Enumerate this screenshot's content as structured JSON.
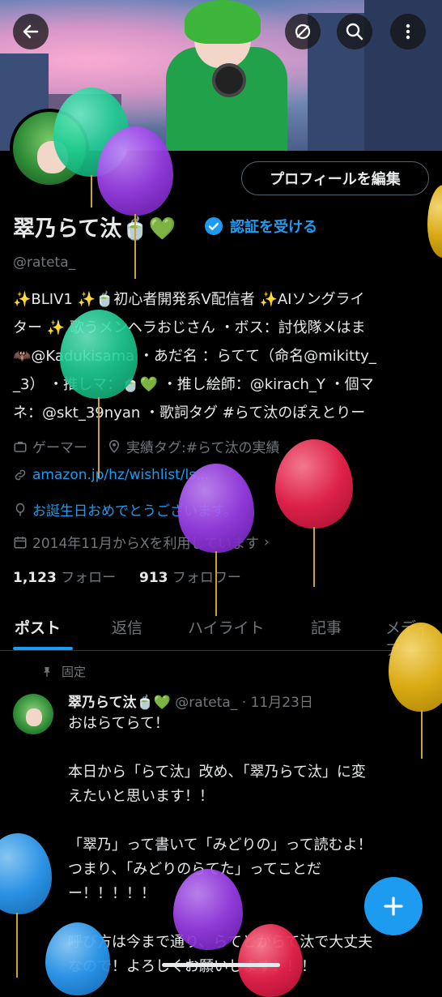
{
  "profile": {
    "display_name": "翠乃らて汰🍵💚",
    "verify_label": "認証を受ける",
    "handle": "@rateta_",
    "edit_button": "プロフィールを編集",
    "bio_lines": [
      "✨BLIV1 ✨🍵初心者開発系V配信者 ✨AIソングライ",
      "ター ✨ 歌うメンヘラおじさん ・ボス：討伐隊メはま",
      "🦇@Kadukisama ・あだ名 ：らてて（命名@mikitty_",
      "_3） ・推しマ：🍵💚 ・推し絵師：@kirach_Y ・個マ",
      "ネ：@skt_39nyan ・歌詞タグ #らて汰のぽえとりー"
    ],
    "category": "ゲーマー",
    "location": "実績タグ:#らて汰の実績",
    "website": "amazon.jp/hz/wishlist/ls...",
    "birthday": "お誕生日おめでとうございます。",
    "joined": "2014年11月からXを利用しています",
    "following_count": "1,123",
    "following_label": "フォロー",
    "followers_count": "913",
    "followers_label": "フォロワー"
  },
  "tabs": [
    "ポスト",
    "返信",
    "ハイライト",
    "記事",
    "メディア"
  ],
  "pinned_post": {
    "pinned_label": "固定",
    "author_name": "翠乃らて汰🍵💚",
    "author_handle": "@rateta_",
    "date": "· 11月23日",
    "lines": [
      "おはらてらて！",
      "",
      "本日から「らて汰」改め、「翠乃らて汰」に変",
      "えたいと思います！！",
      "",
      "「翠乃」って書いて「みどりの」って読むよ！",
      "つまり、「みどりのらてた」ってことだ",
      "ー！！！！！",
      "",
      "呼び方は今まで通り、らてとからて汰で大丈夫",
      "なので！よろしくお願いします！！！"
    ]
  },
  "icons": [
    "back-arrow-icon",
    "bell-off-icon",
    "search-icon",
    "more-vert-icon",
    "briefcase-icon",
    "location-icon",
    "link-icon",
    "balloon-icon",
    "calendar-icon",
    "pin-icon",
    "plus-icon",
    "verified-badge-icon"
  ],
  "colors": {
    "accent": "#1d9bf0",
    "background": "#000000",
    "text": "#e7e9ea",
    "muted": "#71767b"
  }
}
